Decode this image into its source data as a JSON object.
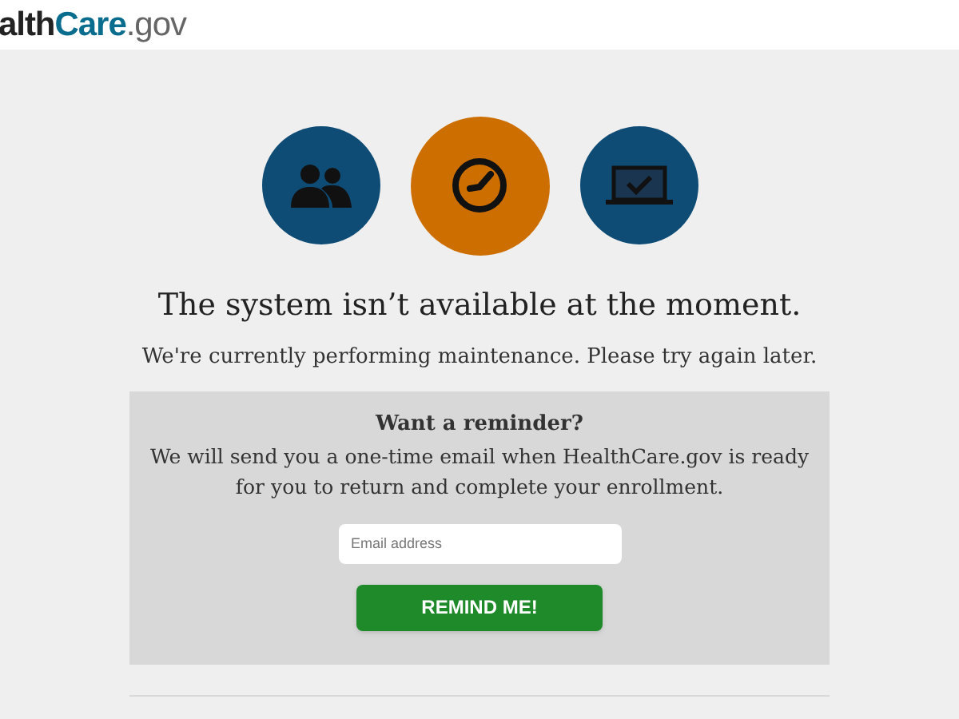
{
  "header": {
    "logo": [
      {
        "kind": "dark",
        "text": "alth"
      },
      {
        "kind": "brand",
        "text": "Care"
      },
      {
        "kind": "muted",
        "text": ".gov"
      }
    ]
  },
  "icons": [
    {
      "kind": "people",
      "color": "#0f4c75"
    },
    {
      "kind": "clock",
      "color": "#cd6f00"
    },
    {
      "kind": "laptop",
      "color": "#0f4c75"
    }
  ],
  "heading": "The system isn’t available at the moment.",
  "message": "We're currently performing maintenance. Please try again later.",
  "reminder": {
    "title": "Want a reminder?",
    "text": "We will send you a one-time email when HealthCare.gov is ready for you to return and complete your enrollment.",
    "email_field": {
      "placeholder": "Email address"
    },
    "button": "REMIND ME!"
  }
}
